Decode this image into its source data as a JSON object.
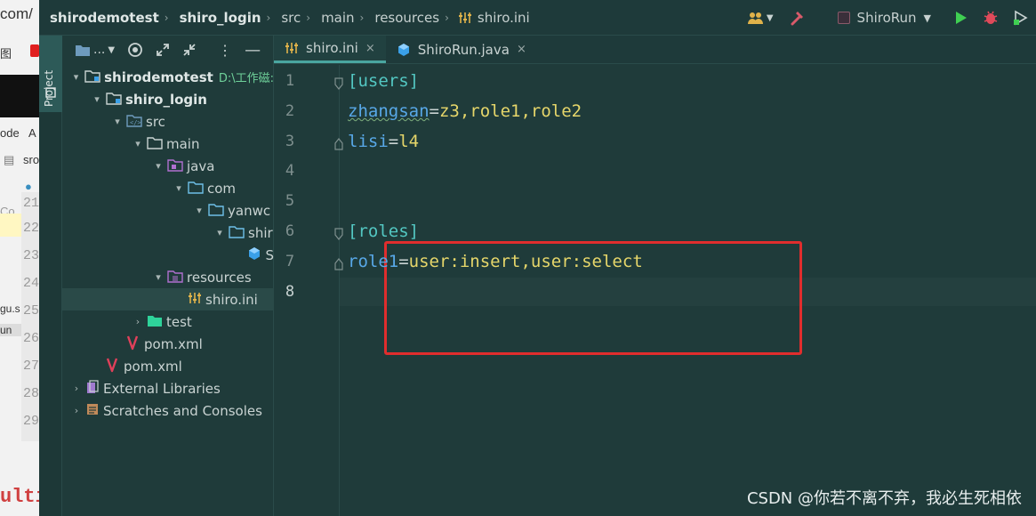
{
  "background": {
    "text_top": "com/",
    "text_2": "图",
    "text_3": "ode",
    "text_3b": "A",
    "text_4": "sro",
    "text_5": "Co",
    "text_6": "gu.s",
    "text_7": "un",
    "text_bottom": "ultir",
    "line_numbers": [
      "21",
      "22",
      "23",
      "24",
      "25",
      "26",
      "27",
      "28",
      "29"
    ]
  },
  "breadcrumb": [
    {
      "label": "shirodemotest"
    },
    {
      "label": "shiro_login"
    },
    {
      "label": "src"
    },
    {
      "label": "main"
    },
    {
      "label": "resources"
    },
    {
      "label": "shiro.ini"
    }
  ],
  "run_config": {
    "label": "ShiroRun"
  },
  "tool_window": {
    "label": "Project"
  },
  "project_panel": {
    "view_label": "..."
  },
  "tree": [
    {
      "label": "shirodemotest",
      "path": "D:\\工作磁:",
      "indent": 0,
      "arrow": "▾",
      "icon": "module-folder-icon",
      "bold": true
    },
    {
      "label": "shiro_login",
      "indent": 1,
      "arrow": "▾",
      "icon": "module-folder-icon",
      "bold": true
    },
    {
      "label": "src",
      "indent": 2,
      "arrow": "▾",
      "icon": "source-folder-icon"
    },
    {
      "label": "main",
      "indent": 3,
      "arrow": "▾",
      "icon": "folder-icon"
    },
    {
      "label": "java",
      "indent": 4,
      "arrow": "▾",
      "icon": "java-source-folder-icon"
    },
    {
      "label": "com",
      "indent": 5,
      "arrow": "▾",
      "icon": "package-icon"
    },
    {
      "label": "yanwc",
      "indent": 6,
      "arrow": "▾",
      "icon": "package-icon"
    },
    {
      "label": "shir",
      "indent": 7,
      "arrow": "▾",
      "icon": "package-icon"
    },
    {
      "label": "S",
      "indent": 8,
      "arrow": "",
      "icon": "java-class-icon"
    },
    {
      "label": "resources",
      "indent": 4,
      "arrow": "▾",
      "icon": "resources-folder-icon"
    },
    {
      "label": "shiro.ini",
      "indent": 5,
      "arrow": "",
      "icon": "ini-file-icon",
      "selected": true
    },
    {
      "label": "test",
      "indent": 3,
      "arrow": "›",
      "icon": "test-folder-icon"
    },
    {
      "label": "pom.xml",
      "indent": 2,
      "arrow": "",
      "icon": "maven-icon"
    },
    {
      "label": "pom.xml",
      "indent": 1,
      "arrow": "",
      "icon": "maven-icon"
    },
    {
      "label": "External Libraries",
      "indent": 0,
      "arrow": "›",
      "icon": "library-icon"
    },
    {
      "label": "Scratches and Consoles",
      "indent": 0,
      "arrow": "›",
      "icon": "scratches-icon"
    }
  ],
  "tabs": [
    {
      "label": "shiro.ini",
      "active": true,
      "icon": "ini-file-icon",
      "close": "×"
    },
    {
      "label": "ShiroRun.java",
      "active": false,
      "icon": "java-class-icon",
      "close": "×"
    }
  ],
  "editor": {
    "line_numbers": [
      "1",
      "2",
      "3",
      "4",
      "5",
      "6",
      "7",
      "8"
    ],
    "lines": [
      {
        "section": "[users]"
      },
      {
        "key": "zhangsan",
        "eq": "=",
        "value": "z3,role1,role2"
      },
      {
        "key": "lisi",
        "eq": "=",
        "value": "l4"
      },
      {},
      {},
      {
        "section": "[roles]"
      },
      {
        "key": "role1",
        "eq": "=",
        "value": "user:insert,user:select"
      },
      {}
    ]
  },
  "watermark": "CSDN @你若不离不弃，我必生死相依",
  "colors": {
    "accent": "#4aa6a0",
    "highlight_box": "#e02d2d",
    "section": "#53c7c2",
    "key": "#58a8e8",
    "value": "#e6d66a"
  }
}
